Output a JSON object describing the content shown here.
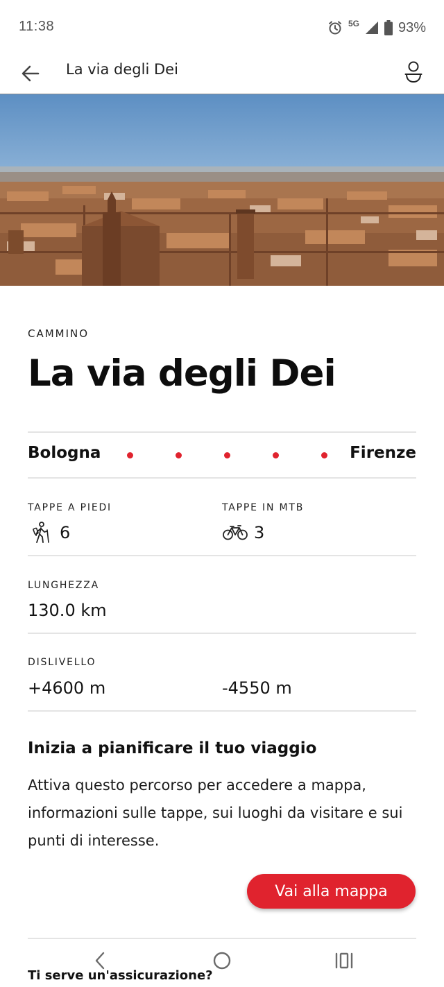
{
  "status_bar": {
    "time": "11:38",
    "network": "5G",
    "battery": "93%"
  },
  "app_bar": {
    "title": "La via degli Dei",
    "back_icon": "arrow-left-icon",
    "profile_icon": "user-icon"
  },
  "hero": {
    "image": "bologna-rooftops-photo"
  },
  "trail": {
    "category": "CAMMINO",
    "name": "La via degli Dei",
    "route": {
      "start": "Bologna",
      "end": "Firenze",
      "dot_color": "#e0232e",
      "dots": 5
    },
    "stages": [
      {
        "label": "TAPPE A PIEDI",
        "icon": "hiking-icon",
        "value": "6"
      },
      {
        "label": "TAPPE IN MTB",
        "icon": "bicycle-icon",
        "value": "3"
      }
    ],
    "length": {
      "label": "LUNGHEZZA",
      "value": "130.0 km"
    },
    "elevation": {
      "label": "DISLIVELLO",
      "gain": "+4600 m",
      "loss": "-4550 m"
    }
  },
  "plan": {
    "title": "Inizia a pianificare il tuo viaggio",
    "text": "Attiva questo percorso per accedere a mappa, informazioni sulle tappe, sui luoghi da visitare e sui punti di interesse.",
    "button": "Vai alla mappa",
    "accent": "#e0232e"
  },
  "insurance": {
    "title": "Ti serve un'assicurazione?"
  },
  "system_nav": {
    "back": "nav-back-icon",
    "home": "nav-home-icon",
    "recents": "nav-recents-icon"
  }
}
